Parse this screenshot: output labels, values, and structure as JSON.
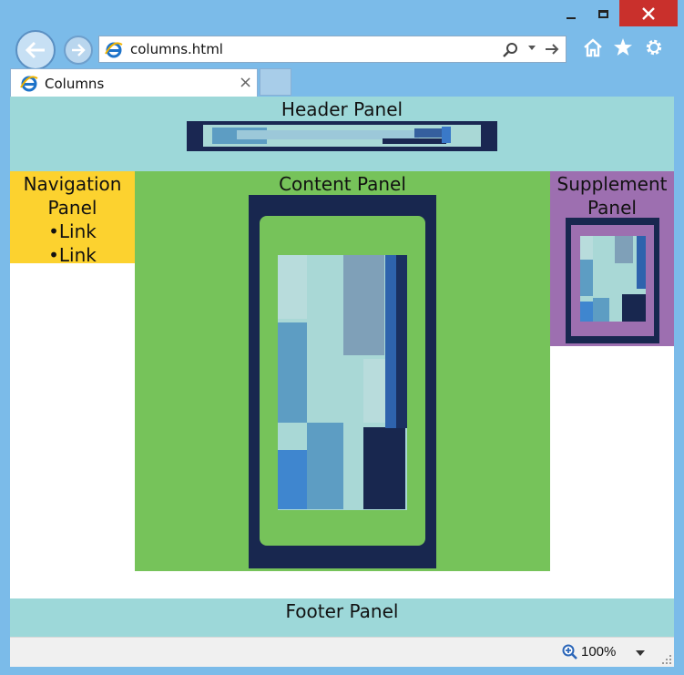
{
  "browser": {
    "url": "columns.html",
    "tab_title": "Columns",
    "zoom": "100%"
  },
  "page": {
    "header_title": "Header Panel",
    "nav_title": [
      "Navigation",
      "Panel"
    ],
    "nav_links": [
      "•Link",
      "•Link"
    ],
    "content_title": "Content Panel",
    "supplement_title": [
      "Supplement",
      "Panel"
    ],
    "footer_title": "Footer Panel"
  },
  "colors": {
    "header": "#9dd8d9",
    "nav": "#fcd22f",
    "content": "#76c35a",
    "supplement": "#9d6fb0",
    "footer": "#9dd8d9",
    "window_frame": "#7bbbe9"
  },
  "icons": [
    "back-arrow-icon",
    "forward-arrow-icon",
    "ie-logo-icon",
    "search-icon",
    "go-arrow-icon",
    "home-icon",
    "star-icon",
    "gear-icon",
    "close-icon",
    "zoom-icon"
  ]
}
